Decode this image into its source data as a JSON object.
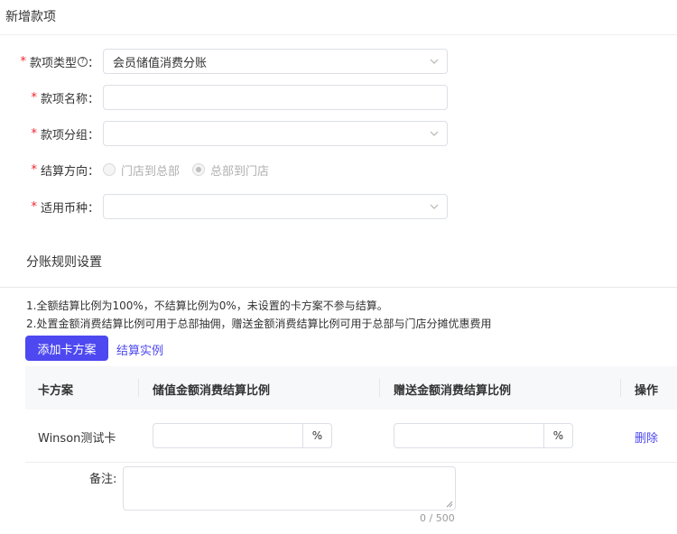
{
  "page": {
    "title": "新增款项"
  },
  "form": {
    "required_mark": "*",
    "type": {
      "label": "款项类型",
      "help_icon": "question-circle-icon",
      "colon": "：",
      "value": "会员储值消费分账"
    },
    "name": {
      "label": "款项名称：",
      "value": ""
    },
    "group": {
      "label": "款项分组：",
      "value": ""
    },
    "direction": {
      "label": "结算方向：",
      "options": [
        {
          "label": "门店到总部",
          "checked": false
        },
        {
          "label": "总部到门店",
          "checked": true
        }
      ]
    },
    "currency": {
      "label": "适用币种：",
      "value": ""
    }
  },
  "rules": {
    "title": "分账规则设置",
    "notes": [
      "1.全额结算比例为100%，不结算比例为0%，未设置的卡方案不参与结算。",
      "2.处置金额消费结算比例可用于总部抽佣，赠送金额消费结算比例可用于总部与门店分摊优惠费用"
    ],
    "add_button": "添加卡方案",
    "example_link": "结算实例",
    "table": {
      "columns": [
        "卡方案",
        "储值金额消费结算比例",
        "赠送金额消费结算比例",
        "操作"
      ],
      "rows": [
        {
          "card": "Winson测试卡",
          "stored_ratio": "",
          "stored_suffix": "%",
          "gift_ratio": "",
          "gift_suffix": "%",
          "action": "删除"
        }
      ]
    },
    "remark": {
      "label": "备注:",
      "value": "",
      "counter": "0 / 500"
    }
  },
  "colors": {
    "primary": "#4d48f0",
    "required": "#f5222d"
  }
}
